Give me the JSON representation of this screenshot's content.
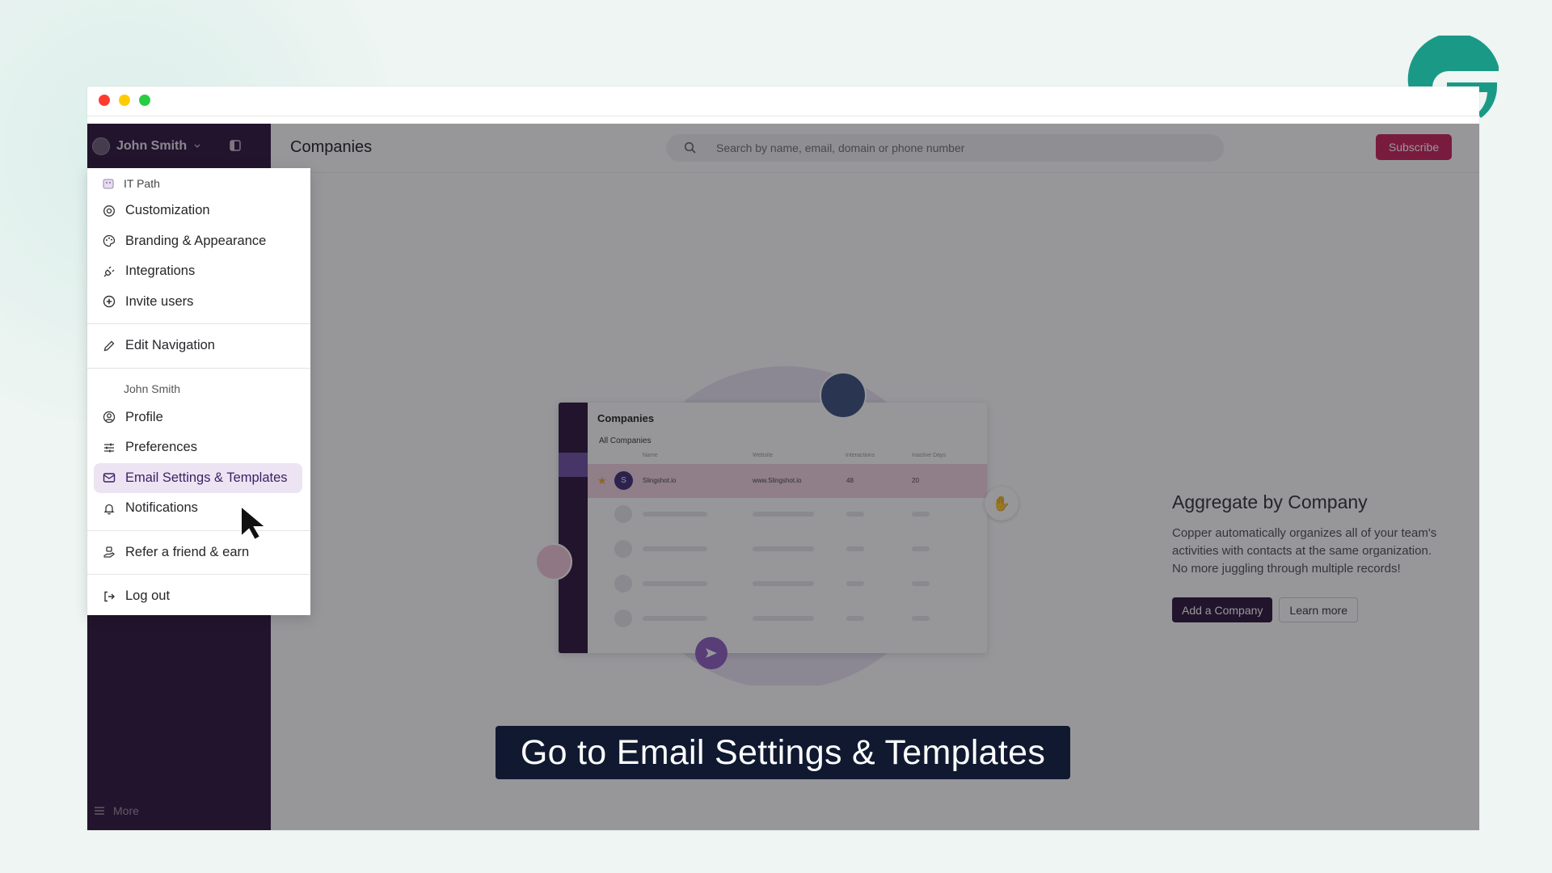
{
  "header": {
    "user_name": "John Smith",
    "page_title": "Companies",
    "search_placeholder": "Search by name, email, domain or phone number",
    "subscribe_label": "Subscribe"
  },
  "menu": {
    "org_name": "IT Path",
    "org_items": [
      {
        "label": "Customization",
        "icon": "gear-icon"
      },
      {
        "label": "Branding & Appearance",
        "icon": "palette-icon"
      },
      {
        "label": "Integrations",
        "icon": "plug-icon"
      },
      {
        "label": "Invite users",
        "icon": "plus-circle-icon"
      }
    ],
    "edit_navigation": "Edit Navigation",
    "user_caption": "John Smith",
    "user_items": [
      {
        "label": "Profile",
        "icon": "user-circle-icon"
      },
      {
        "label": "Preferences",
        "icon": "sliders-icon"
      },
      {
        "label": "Email Settings & Templates",
        "icon": "mail-icon",
        "active": true
      },
      {
        "label": "Notifications",
        "icon": "bell-icon"
      }
    ],
    "refer_label": "Refer a friend & earn",
    "logout_label": "Log out"
  },
  "sidebar": {
    "more_label": "More"
  },
  "illustration": {
    "title": "Companies",
    "filter": "All Companies",
    "columns": [
      "Name",
      "Website",
      "Interactions",
      "Inactive Days"
    ],
    "row": {
      "initial": "S",
      "name": "Slingshot.io",
      "website": "www.Slingshot.io",
      "interactions": "48",
      "inactive_days": "20"
    }
  },
  "empty_state": {
    "title": "Aggregate by Company",
    "description": "Copper automatically organizes all of your team's activities with contacts at the same organization. No more juggling through multiple records!",
    "primary_button": "Add a Company",
    "secondary_button": "Learn more"
  },
  "caption": "Go to Email Settings & Templates",
  "colors": {
    "sidebar": "#2a1238",
    "subscribe": "#c81e57",
    "highlight_row": "#f3d2de",
    "menu_active": "#ece4f3",
    "logo_teal": "#1a9a86"
  }
}
